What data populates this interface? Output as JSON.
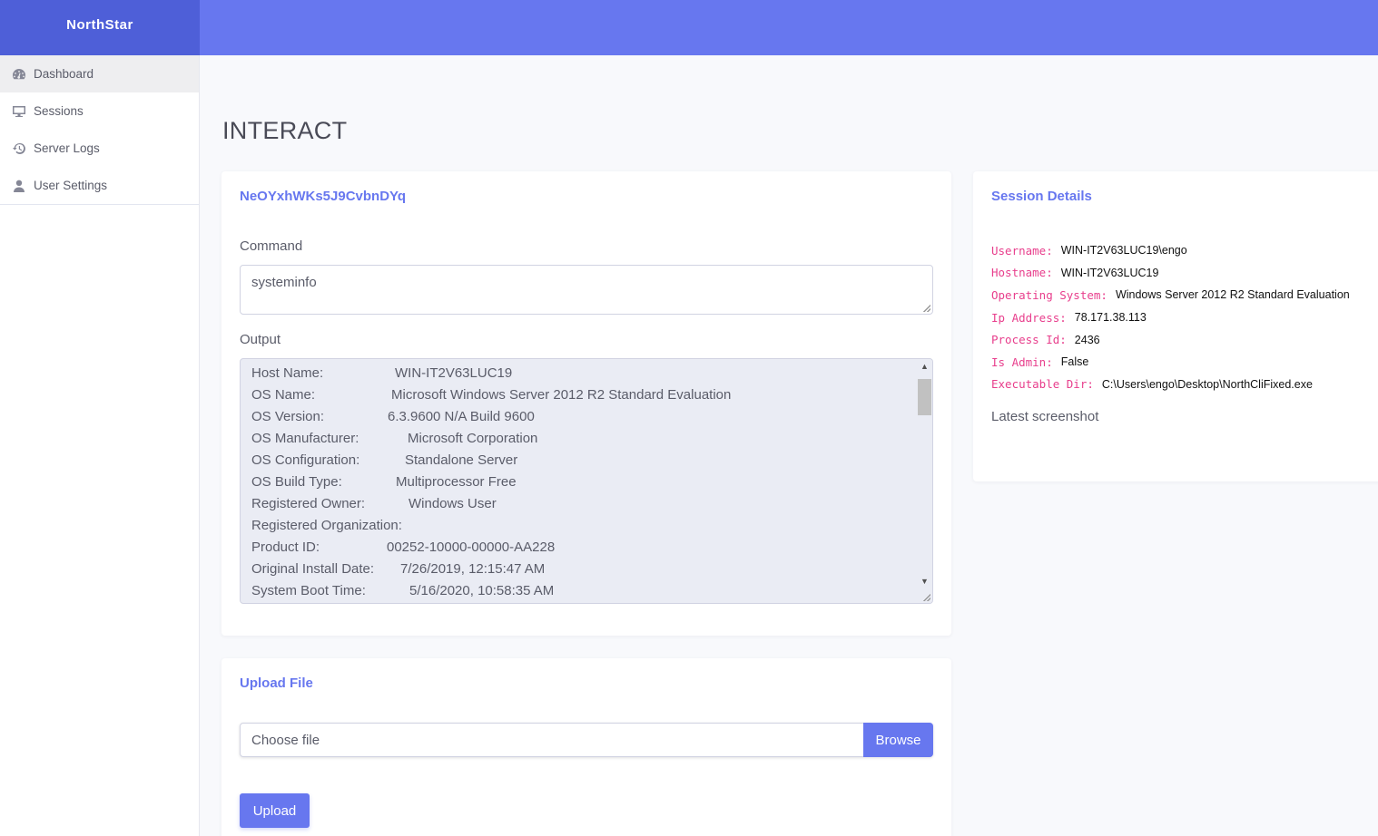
{
  "brand": "NorthStar",
  "sidebar": {
    "items": [
      {
        "label": "Dashboard",
        "icon": "tachometer-icon"
      },
      {
        "label": "Sessions",
        "icon": "desktop-icon"
      },
      {
        "label": "Server Logs",
        "icon": "history-icon"
      },
      {
        "label": "User Settings",
        "icon": "user-icon"
      }
    ]
  },
  "page_title": "INTERACT",
  "interact": {
    "session_id": "NeOYxhWKs5J9CvbnDYq",
    "command_label": "Command",
    "command_value": "systeminfo",
    "output_label": "Output",
    "output_lines": [
      {
        "key": "Host Name:",
        "value": "WIN-IT2V63LUC19"
      },
      {
        "key": "OS Name:",
        "value": "Microsoft Windows Server 2012 R2 Standard Evaluation"
      },
      {
        "key": "OS Version:",
        "value": "6.3.9600 N/A Build 9600"
      },
      {
        "key": "OS Manufacturer:",
        "value": "Microsoft Corporation"
      },
      {
        "key": "OS Configuration:",
        "value": "Standalone Server"
      },
      {
        "key": "OS Build Type:",
        "value": "Multiprocessor Free"
      },
      {
        "key": "Registered Owner:",
        "value": "Windows User"
      },
      {
        "key": "Registered Organization:",
        "value": ""
      },
      {
        "key": "Product ID:",
        "value": "00252-10000-00000-AA228"
      },
      {
        "key": "Original Install Date:",
        "value": "7/26/2019, 12:15:47 AM"
      },
      {
        "key": "System Boot Time:",
        "value": "5/16/2020, 10:58:35 AM"
      }
    ]
  },
  "upload": {
    "title": "Upload File",
    "placeholder": "Choose file",
    "browse_label": "Browse",
    "upload_label": "Upload"
  },
  "session_details": {
    "title": "Session Details",
    "rows": [
      {
        "key": "Username:",
        "value": "WIN-IT2V63LUC19\\engo"
      },
      {
        "key": "Hostname:",
        "value": "WIN-IT2V63LUC19"
      },
      {
        "key": "Operating System:",
        "value": "Windows Server 2012 R2 Standard Evaluation"
      },
      {
        "key": "Ip Address:",
        "value": "78.171.38.113"
      },
      {
        "key": "Process Id:",
        "value": "2436"
      },
      {
        "key": "Is Admin:",
        "value": "False"
      },
      {
        "key": "Executable Dir:",
        "value": "C:\\Users\\engo\\Desktop\\NorthCliFixed.exe"
      }
    ],
    "latest_screenshot_label": "Latest screenshot"
  },
  "colors": {
    "accent": "#6777ef",
    "brand_bg": "#4e5fd8",
    "key_pink": "#e83e8c"
  }
}
